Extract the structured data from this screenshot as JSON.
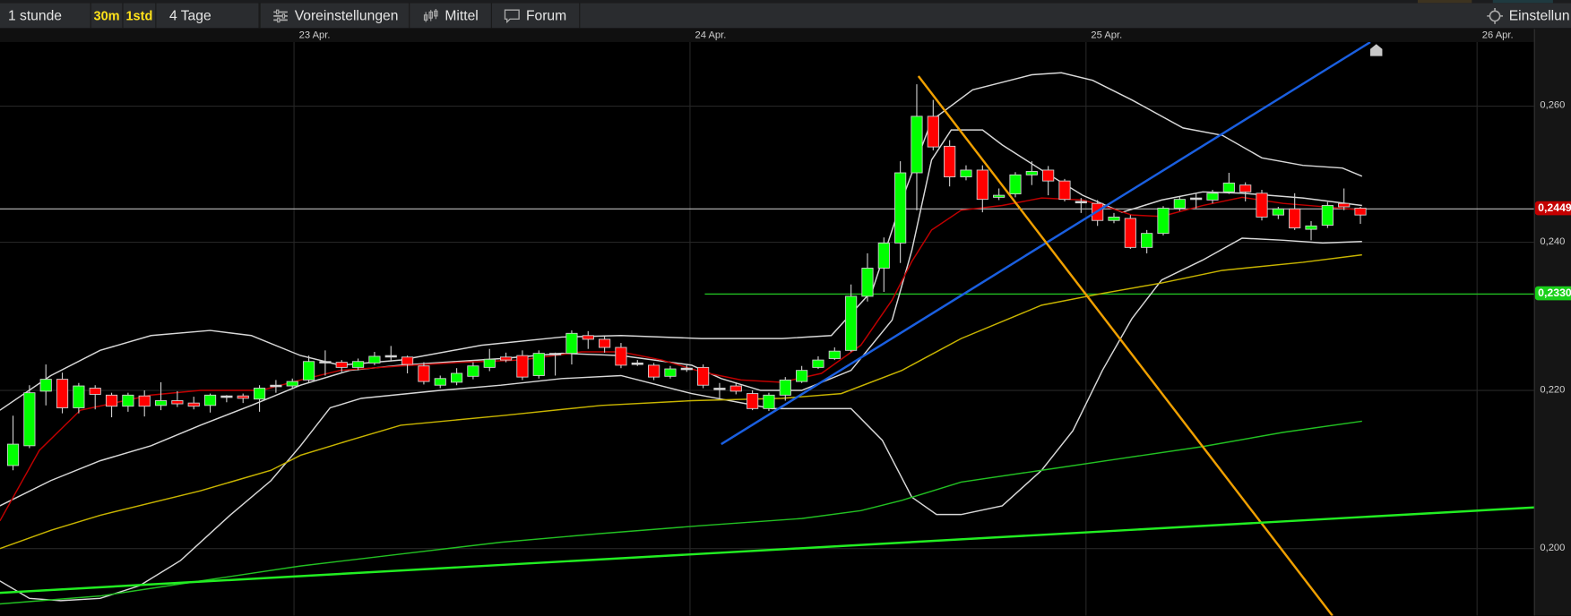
{
  "toolbar": {
    "interval_label": "1 stunde",
    "btn_30m": "30m",
    "btn_1std": "1std",
    "range_label": "4 Tage",
    "presets_label": "Voreinstellungen",
    "presets_icon": "sliders-icon",
    "chart_type_label": "Mittel",
    "chart_type_icon": "candlestick-icon",
    "forum_label": "Forum",
    "forum_icon": "speech-bubble-icon",
    "settings_label": "Einstellun",
    "settings_icon": "gear-icon"
  },
  "colors": {
    "toolbar_bg": "#2a2c2f",
    "highlight": "#ffe21a",
    "up": "#00ff00",
    "down": "#ff0000",
    "bb": "#d8d8d8",
    "ema": "#c00000",
    "ma_yellow": "#c8b400",
    "ma_green": "#22c022",
    "trend_blue": "#1a5fe0",
    "trend_orange": "#f0a000",
    "trend_green": "#22ee22"
  },
  "chart_data": {
    "type": "candlestick",
    "x_axis": {
      "labels": [
        {
          "text": "23 Apr.",
          "index": 17.1
        },
        {
          "text": "24 Apr.",
          "index": 41.2
        },
        {
          "text": "25 Apr.",
          "index": 65.3
        },
        {
          "text": "26 Apr.",
          "index": 89.1
        }
      ]
    },
    "y_axis": {
      "ticks": [
        {
          "value": 0.26,
          "label": "0,260"
        },
        {
          "value": 0.24,
          "label": "0,240"
        },
        {
          "value": 0.22,
          "label": "0,220"
        },
        {
          "value": 0.2,
          "label": "0,200"
        }
      ],
      "side": "right"
    },
    "current_price": {
      "value": 0.2449,
      "label": "0,2449"
    },
    "level_line": {
      "value": 0.233,
      "label": "0,2330",
      "from_index": 42.1
    },
    "candles_ohlc": [
      [
        0.2105,
        0.2168,
        0.2099,
        0.2132
      ],
      [
        0.213,
        0.2207,
        0.2127,
        0.2197
      ],
      [
        0.2199,
        0.2235,
        0.2181,
        0.2215
      ],
      [
        0.2215,
        0.2224,
        0.2171,
        0.2178
      ],
      [
        0.2178,
        0.221,
        0.2171,
        0.2206
      ],
      [
        0.2203,
        0.2207,
        0.2176,
        0.2195
      ],
      [
        0.2194,
        0.2197,
        0.2166,
        0.218
      ],
      [
        0.218,
        0.2197,
        0.2173,
        0.2194
      ],
      [
        0.2193,
        0.22,
        0.2167,
        0.218
      ],
      [
        0.2181,
        0.2211,
        0.2175,
        0.2187
      ],
      [
        0.2187,
        0.2199,
        0.2179,
        0.2183
      ],
      [
        0.2184,
        0.2192,
        0.2176,
        0.218
      ],
      [
        0.2181,
        0.2196,
        0.2172,
        0.2194
      ],
      [
        0.2193,
        0.2194,
        0.2185,
        0.2193
      ],
      [
        0.2193,
        0.2196,
        0.2184,
        0.219
      ],
      [
        0.2189,
        0.2207,
        0.2173,
        0.2203
      ],
      [
        0.2207,
        0.2214,
        0.2197,
        0.2207
      ],
      [
        0.2206,
        0.2216,
        0.2203,
        0.2212
      ],
      [
        0.2214,
        0.2247,
        0.221,
        0.2239
      ],
      [
        0.2239,
        0.2254,
        0.222,
        0.2239
      ],
      [
        0.2238,
        0.2241,
        0.2225,
        0.2231
      ],
      [
        0.2231,
        0.2243,
        0.2227,
        0.2239
      ],
      [
        0.2237,
        0.2252,
        0.2234,
        0.2246
      ],
      [
        0.2247,
        0.226,
        0.2239,
        0.2247
      ],
      [
        0.2245,
        0.2247,
        0.2223,
        0.2235
      ],
      [
        0.2233,
        0.2238,
        0.2208,
        0.2212
      ],
      [
        0.2207,
        0.222,
        0.2203,
        0.2216
      ],
      [
        0.2211,
        0.223,
        0.2207,
        0.2223
      ],
      [
        0.2219,
        0.2238,
        0.2215,
        0.2233
      ],
      [
        0.2231,
        0.2256,
        0.2226,
        0.2242
      ],
      [
        0.2245,
        0.2251,
        0.2238,
        0.2241
      ],
      [
        0.2247,
        0.2254,
        0.2214,
        0.2218
      ],
      [
        0.222,
        0.2254,
        0.2216,
        0.225
      ],
      [
        0.225,
        0.2251,
        0.222,
        0.225
      ],
      [
        0.225,
        0.2281,
        0.2235,
        0.2277
      ],
      [
        0.2274,
        0.228,
        0.2256,
        0.2269
      ],
      [
        0.2269,
        0.2273,
        0.2251,
        0.2258
      ],
      [
        0.2258,
        0.2264,
        0.223,
        0.2234
      ],
      [
        0.2237,
        0.2241,
        0.2233,
        0.2237
      ],
      [
        0.2234,
        0.2237,
        0.2214,
        0.2218
      ],
      [
        0.2219,
        0.2233,
        0.2216,
        0.2229
      ],
      [
        0.223,
        0.2234,
        0.2225,
        0.223
      ],
      [
        0.2231,
        0.2235,
        0.2203,
        0.2207
      ],
      [
        0.2203,
        0.221,
        0.219,
        0.2203
      ],
      [
        0.2206,
        0.2211,
        0.2195,
        0.2199
      ],
      [
        0.2196,
        0.22,
        0.2175,
        0.2177
      ],
      [
        0.2177,
        0.2197,
        0.2174,
        0.2194
      ],
      [
        0.2194,
        0.2218,
        0.2187,
        0.2214
      ],
      [
        0.2212,
        0.2233,
        0.221,
        0.2227
      ],
      [
        0.2231,
        0.2246,
        0.2229,
        0.2241
      ],
      [
        0.2243,
        0.2258,
        0.2241,
        0.2253
      ],
      [
        0.2254,
        0.2343,
        0.2252,
        0.2327
      ],
      [
        0.2327,
        0.2385,
        0.232,
        0.2365
      ],
      [
        0.2365,
        0.2407,
        0.2333,
        0.2399
      ],
      [
        0.2399,
        0.2519,
        0.2372,
        0.2502
      ],
      [
        0.2502,
        0.2632,
        0.2447,
        0.2585
      ],
      [
        0.2585,
        0.2609,
        0.2535,
        0.254
      ],
      [
        0.2541,
        0.255,
        0.2482,
        0.2496
      ],
      [
        0.2496,
        0.2513,
        0.2491,
        0.2506
      ],
      [
        0.2506,
        0.2513,
        0.2444,
        0.2463
      ],
      [
        0.2466,
        0.2479,
        0.2462,
        0.2469
      ],
      [
        0.2471,
        0.2503,
        0.2466,
        0.2499
      ],
      [
        0.2499,
        0.2519,
        0.2484,
        0.2504
      ],
      [
        0.2506,
        0.2512,
        0.2469,
        0.249
      ],
      [
        0.249,
        0.2493,
        0.246,
        0.2463
      ],
      [
        0.246,
        0.2465,
        0.2443,
        0.246
      ],
      [
        0.2457,
        0.2462,
        0.2424,
        0.2432
      ],
      [
        0.2432,
        0.2443,
        0.2428,
        0.2437
      ],
      [
        0.2435,
        0.244,
        0.2391,
        0.2393
      ],
      [
        0.2393,
        0.2418,
        0.2385,
        0.2413
      ],
      [
        0.2413,
        0.2453,
        0.241,
        0.245
      ],
      [
        0.245,
        0.2468,
        0.2446,
        0.2463
      ],
      [
        0.2465,
        0.2472,
        0.245,
        0.2465
      ],
      [
        0.2462,
        0.2477,
        0.2457,
        0.2472
      ],
      [
        0.2474,
        0.2502,
        0.2471,
        0.2487
      ],
      [
        0.2484,
        0.2488,
        0.246,
        0.2474
      ],
      [
        0.2472,
        0.2477,
        0.2432,
        0.2437
      ],
      [
        0.244,
        0.2452,
        0.2434,
        0.2449
      ],
      [
        0.2449,
        0.2472,
        0.2418,
        0.2421
      ],
      [
        0.2419,
        0.2431,
        0.2403,
        0.2424
      ],
      [
        0.2425,
        0.2459,
        0.2421,
        0.2454
      ],
      [
        0.2457,
        0.2479,
        0.2447,
        0.2452
      ],
      [
        0.245,
        0.2452,
        0.2427,
        0.244
      ]
    ],
    "indicators": [
      {
        "name": "bollinger-upper",
        "color": "#d8d8d8",
        "points": [
          [
            -0.8,
            0.2175
          ],
          [
            2.3,
            0.222
          ],
          [
            5.3,
            0.2254
          ],
          [
            8.4,
            0.2274
          ],
          [
            12.0,
            0.2281
          ],
          [
            14.5,
            0.2274
          ],
          [
            17.5,
            0.2247
          ],
          [
            19.9,
            0.2234
          ],
          [
            23.6,
            0.2241
          ],
          [
            28.5,
            0.2261
          ],
          [
            33.4,
            0.2272
          ],
          [
            37,
            0.2274
          ],
          [
            41.9,
            0.227
          ],
          [
            46.8,
            0.227
          ],
          [
            49.8,
            0.2274
          ],
          [
            52.3,
            0.2335
          ],
          [
            54.1,
            0.2462
          ],
          [
            55.9,
            0.2579
          ],
          [
            58.4,
            0.2624
          ],
          [
            60.2,
            0.2635
          ],
          [
            62,
            0.2646
          ],
          [
            63.8,
            0.2649
          ],
          [
            65.7,
            0.2638
          ],
          [
            68.1,
            0.2609
          ],
          [
            71.2,
            0.2568
          ],
          [
            73.6,
            0.2557
          ],
          [
            76,
            0.2524
          ],
          [
            78.5,
            0.2513
          ],
          [
            80.9,
            0.2509
          ],
          [
            82.1,
            0.2497
          ]
        ]
      },
      {
        "name": "bollinger-middle",
        "color": "#d8d8d8",
        "points": [
          [
            -0.8,
            0.2054
          ],
          [
            2.3,
            0.2086
          ],
          [
            5.3,
            0.2111
          ],
          [
            8.4,
            0.213
          ],
          [
            11.4,
            0.2156
          ],
          [
            14.5,
            0.2181
          ],
          [
            17.5,
            0.2207
          ],
          [
            20.5,
            0.2227
          ],
          [
            23.6,
            0.2234
          ],
          [
            29.7,
            0.2243
          ],
          [
            33.4,
            0.225
          ],
          [
            37,
            0.2247
          ],
          [
            41.3,
            0.2234
          ],
          [
            43.1,
            0.2216
          ],
          [
            45.5,
            0.22
          ],
          [
            48,
            0.22
          ],
          [
            51,
            0.2227
          ],
          [
            53.5,
            0.2295
          ],
          [
            54.7,
            0.2389
          ],
          [
            55.9,
            0.2521
          ],
          [
            57.1,
            0.2565
          ],
          [
            59,
            0.2565
          ],
          [
            60.2,
            0.2543
          ],
          [
            62.6,
            0.2506
          ],
          [
            65.1,
            0.2469
          ],
          [
            67.5,
            0.2444
          ],
          [
            69.9,
            0.2462
          ],
          [
            72.4,
            0.2474
          ],
          [
            74.8,
            0.2472
          ],
          [
            78.5,
            0.2465
          ],
          [
            82.1,
            0.2454
          ]
        ]
      },
      {
        "name": "bollinger-lower",
        "color": "#d8d8d8",
        "points": [
          [
            -0.8,
            0.1959
          ],
          [
            1,
            0.1937
          ],
          [
            2.9,
            0.1934
          ],
          [
            5.3,
            0.1937
          ],
          [
            7.7,
            0.1953
          ],
          [
            10.2,
            0.1985
          ],
          [
            13.2,
            0.2042
          ],
          [
            15.7,
            0.2086
          ],
          [
            17.5,
            0.213
          ],
          [
            19.3,
            0.2178
          ],
          [
            21.2,
            0.219
          ],
          [
            26,
            0.22
          ],
          [
            29.7,
            0.2207
          ],
          [
            33.4,
            0.2216
          ],
          [
            37,
            0.222
          ],
          [
            41.3,
            0.2196
          ],
          [
            46.2,
            0.2177
          ],
          [
            51,
            0.2177
          ],
          [
            52.9,
            0.2137
          ],
          [
            54.7,
            0.2065
          ],
          [
            56.2,
            0.2043
          ],
          [
            57.7,
            0.2043
          ],
          [
            60.2,
            0.2054
          ],
          [
            62.6,
            0.2099
          ],
          [
            64.5,
            0.2149
          ],
          [
            66.3,
            0.2227
          ],
          [
            68.1,
            0.2297
          ],
          [
            69.9,
            0.2349
          ],
          [
            72.4,
            0.2376
          ],
          [
            74.8,
            0.2406
          ],
          [
            77.3,
            0.2403
          ],
          [
            79.7,
            0.2399
          ],
          [
            82.1,
            0.2401
          ]
        ]
      },
      {
        "name": "ema-red",
        "color": "#c00000",
        "points": [
          [
            -0.8,
            0.2035
          ],
          [
            1.6,
            0.2124
          ],
          [
            4.1,
            0.2175
          ],
          [
            8.4,
            0.2194
          ],
          [
            11.4,
            0.22
          ],
          [
            15.1,
            0.22
          ],
          [
            17.5,
            0.2214
          ],
          [
            19.9,
            0.2227
          ],
          [
            23.6,
            0.2233
          ],
          [
            27.3,
            0.2238
          ],
          [
            30.9,
            0.2241
          ],
          [
            34.6,
            0.2252
          ],
          [
            37,
            0.2252
          ],
          [
            39.5,
            0.2241
          ],
          [
            41.9,
            0.2225
          ],
          [
            44.3,
            0.2214
          ],
          [
            46.8,
            0.2211
          ],
          [
            49.2,
            0.2223
          ],
          [
            51.6,
            0.2261
          ],
          [
            53.5,
            0.2322
          ],
          [
            54.7,
            0.2374
          ],
          [
            55.9,
            0.2418
          ],
          [
            57.7,
            0.2447
          ],
          [
            60.2,
            0.2454
          ],
          [
            62.6,
            0.2465
          ],
          [
            65.1,
            0.2462
          ],
          [
            66.3,
            0.2454
          ],
          [
            68.1,
            0.244
          ],
          [
            69.9,
            0.2438
          ],
          [
            72.4,
            0.2454
          ],
          [
            74.8,
            0.2466
          ],
          [
            77.3,
            0.2457
          ],
          [
            80.9,
            0.245
          ],
          [
            82.1,
            0.2447
          ]
        ]
      },
      {
        "name": "ma-yellow",
        "color": "#c8b400",
        "points": [
          [
            -0.8,
            0.2
          ],
          [
            2.3,
            0.2023
          ],
          [
            5.3,
            0.2042
          ],
          [
            11.4,
            0.2073
          ],
          [
            15.7,
            0.2099
          ],
          [
            17.5,
            0.2118
          ],
          [
            20.5,
            0.2137
          ],
          [
            23.6,
            0.2156
          ],
          [
            29.7,
            0.2168
          ],
          [
            35.8,
            0.2181
          ],
          [
            41.3,
            0.2187
          ],
          [
            46.8,
            0.219
          ],
          [
            50.4,
            0.2196
          ],
          [
            54.1,
            0.2227
          ],
          [
            57.7,
            0.227
          ],
          [
            62.6,
            0.2315
          ],
          [
            66.3,
            0.2331
          ],
          [
            69.9,
            0.2345
          ],
          [
            73.6,
            0.2362
          ],
          [
            78.5,
            0.2373
          ],
          [
            82.1,
            0.2383
          ]
        ]
      },
      {
        "name": "ma-green",
        "color": "#22c022",
        "points": [
          [
            -0.8,
            0.193
          ],
          [
            5.3,
            0.194
          ],
          [
            11.4,
            0.1959
          ],
          [
            17.5,
            0.1978
          ],
          [
            23.6,
            0.1993
          ],
          [
            29.7,
            0.2008
          ],
          [
            35.8,
            0.2019
          ],
          [
            41.9,
            0.2029
          ],
          [
            48,
            0.2038
          ],
          [
            51.6,
            0.2048
          ],
          [
            54.1,
            0.2061
          ],
          [
            57.7,
            0.2084
          ],
          [
            62.6,
            0.2099
          ],
          [
            67.5,
            0.2114
          ],
          [
            72.4,
            0.2129
          ],
          [
            77.3,
            0.2147
          ],
          [
            82.1,
            0.2161
          ]
        ]
      }
    ],
    "trendlines": [
      {
        "name": "trendline-blue",
        "color": "#1a5fe0",
        "from": [
          43.1,
          0.2132
        ],
        "to": [
          82.6,
          0.2694
        ]
      },
      {
        "name": "trendline-orange",
        "color": "#f0a000",
        "from": [
          55.1,
          0.2644
        ],
        "to": [
          80.3,
          0.1915
        ]
      },
      {
        "name": "trendline-green",
        "color": "#22ee22",
        "from": [
          -0.8,
          0.1944
        ],
        "to": [
          92.6,
          0.2052
        ]
      }
    ]
  }
}
